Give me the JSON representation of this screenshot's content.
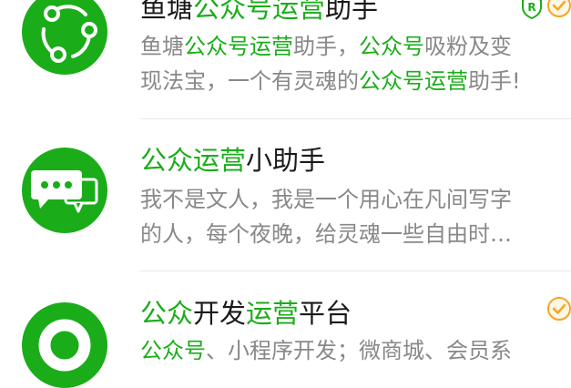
{
  "accent_color": "#1aad19",
  "results": [
    {
      "icon": "share-nodes-icon",
      "title": [
        {
          "text": "鱼塘",
          "hl": false
        },
        {
          "text": "公众号",
          "hl": true
        },
        {
          "text": "运营",
          "hl": true
        },
        {
          "text": "助手",
          "hl": false
        }
      ],
      "desc_line1": [
        {
          "text": "鱼塘",
          "hl": false
        },
        {
          "text": "公众号",
          "hl": true
        },
        {
          "text": "运营",
          "hl": true
        },
        {
          "text": "助手，",
          "hl": false
        },
        {
          "text": "公众号",
          "hl": true
        },
        {
          "text": "吸粉及变",
          "hl": false
        }
      ],
      "desc_line2": [
        {
          "text": "现法宝，一个有灵魂的",
          "hl": false
        },
        {
          "text": "公众号",
          "hl": true
        },
        {
          "text": "运营",
          "hl": true
        },
        {
          "text": "助手!",
          "hl": false
        }
      ],
      "badges": [
        "shield-r-icon",
        "verified-check-icon"
      ]
    },
    {
      "icon": "chat-bubbles-icon",
      "title": [
        {
          "text": "公众",
          "hl": true
        },
        {
          "text": "运营",
          "hl": true
        },
        {
          "text": "小助手",
          "hl": false
        }
      ],
      "desc_line1": [
        {
          "text": "我不是文人，我是一个用心在凡间写字",
          "hl": false
        }
      ],
      "desc_line2": [
        {
          "text": "的人，每个夜晚，给灵魂一些自由时…",
          "hl": false
        }
      ],
      "badges": []
    },
    {
      "icon": "mini-program-icon",
      "title": [
        {
          "text": "公众",
          "hl": true
        },
        {
          "text": "开发",
          "hl": false
        },
        {
          "text": "运营",
          "hl": true
        },
        {
          "text": "平台",
          "hl": false
        }
      ],
      "desc_line1": [
        {
          "text": "公众号",
          "hl": true
        },
        {
          "text": "、小程序开发；微商城、会员系",
          "hl": false
        }
      ],
      "desc_line2": [],
      "badges": [
        "verified-check-icon"
      ]
    }
  ]
}
